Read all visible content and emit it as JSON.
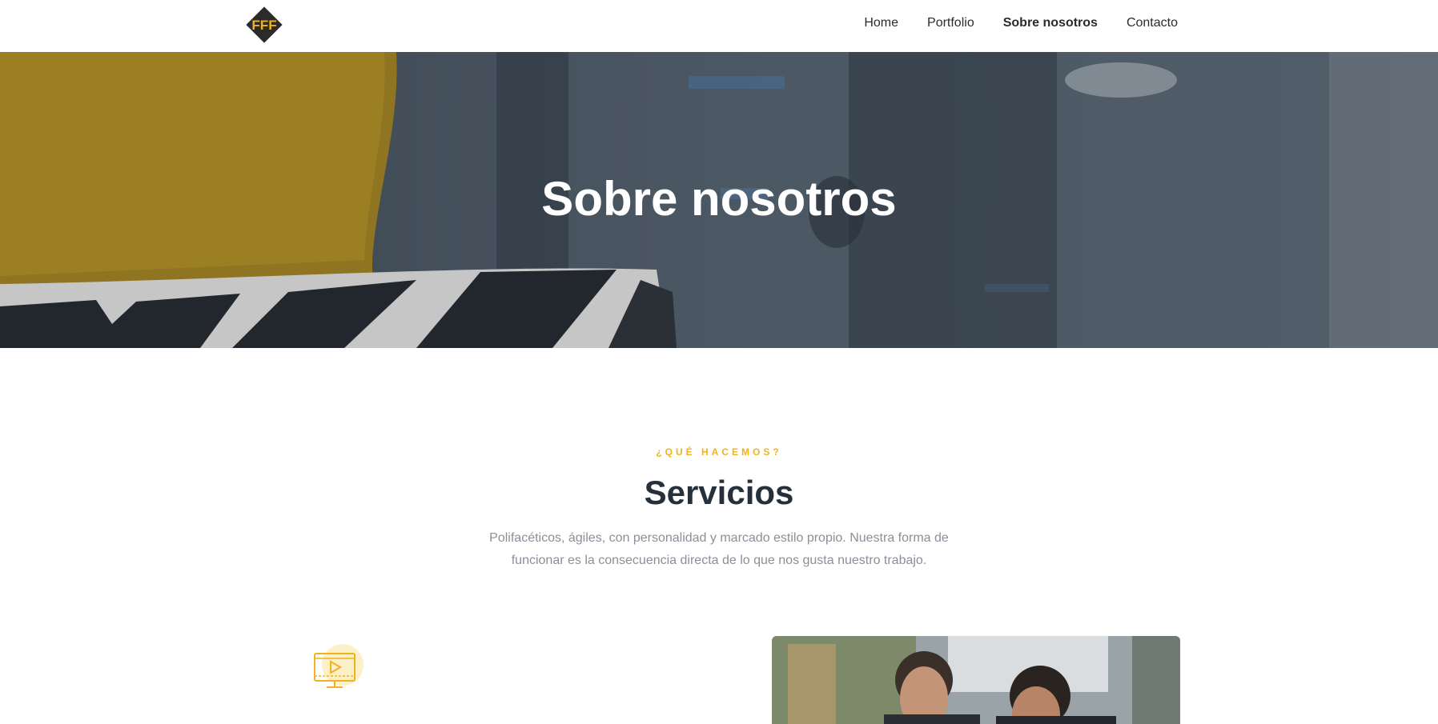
{
  "nav": {
    "logo_alt": "FFF",
    "links": [
      {
        "label": "Home"
      },
      {
        "label": "Portfolio"
      },
      {
        "label": "Sobre nosotros"
      },
      {
        "label": "Contacto"
      }
    ]
  },
  "hero": {
    "title": "Sobre nosotros"
  },
  "services": {
    "eyebrow": "¿QUÉ HACEMOS?",
    "title": "Servicios",
    "description": "Polifacéticos, ágiles, con personalidad y marcado estilo propio. Nuestra forma de funcionar es la consecuencia directa de lo que nos gusta nuestro trabajo.",
    "icon": "video-screen-icon"
  },
  "colors": {
    "accent": "#f0b31b",
    "heading": "#25303a",
    "muted_text": "#8a8f98",
    "logo_bg": "#2b2b2b"
  }
}
